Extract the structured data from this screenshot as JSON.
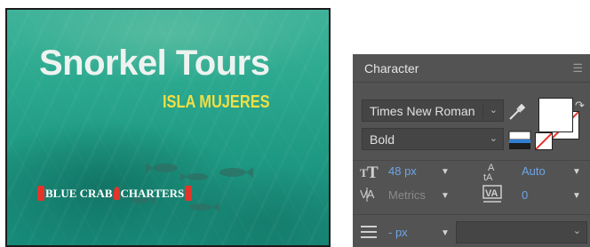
{
  "artboard": {
    "title": "Snorkel Tours",
    "subtitle": "ISLA MUJERES",
    "selected_text": {
      "part1": "BLUE CRAB",
      "part2": "CHARTERS"
    }
  },
  "panel": {
    "title": "Character",
    "menu_icon": "hamburger-menu-icon",
    "font_family": "Times New Roman",
    "font_style": "Bold",
    "fill_color": "#ffffff",
    "stroke_color": "#e6332a",
    "font_size": {
      "value": "48 px"
    },
    "leading": {
      "value": "Auto"
    },
    "kerning": {
      "value": "Metrics"
    },
    "tracking": {
      "value": "0"
    },
    "indent": {
      "value": "- px"
    }
  },
  "colors": {
    "panel_bg": "#535353",
    "accent_blue": "#6fa4e6",
    "title_yellow": "#f1df44",
    "selection_red": "#e6332a"
  }
}
